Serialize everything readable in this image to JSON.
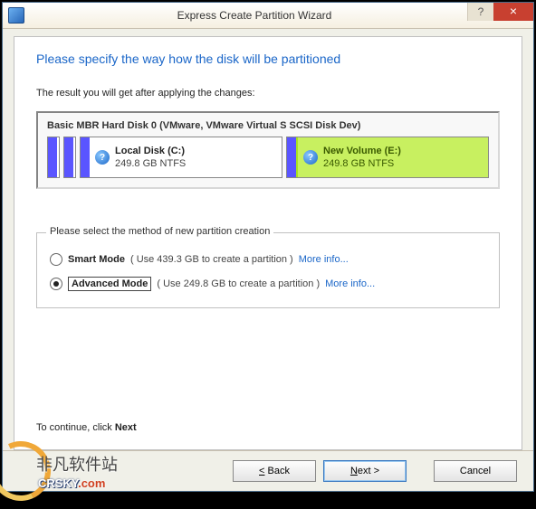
{
  "window": {
    "title": "Express Create Partition Wizard"
  },
  "main": {
    "heading": "Please specify the way how the disk will be partitioned",
    "result_label": "The result you will get after applying the changes:"
  },
  "disk": {
    "title": "Basic MBR Hard Disk 0 (VMware, VMware Virtual S SCSI Disk Dev)",
    "partitions": [
      {
        "name": "Local Disk (C:)",
        "size": "249.8 GB NTFS"
      },
      {
        "name": "New Volume (E:)",
        "size": "249.8 GB NTFS"
      }
    ]
  },
  "method": {
    "legend": "Please select the method of new partition creation",
    "smart": {
      "label": "Smart Mode",
      "desc": "( Use 439.3 GB to create a partition )",
      "more": "More info..."
    },
    "advanced": {
      "label": "Advanced Mode",
      "desc": "( Use 249.8 GB to create a partition )",
      "more": "More info..."
    }
  },
  "footer": {
    "continue_prefix": "To continue, click ",
    "continue_bold": "Next",
    "back": "< Back",
    "next": "Next >",
    "cancel": "Cancel"
  },
  "watermark": {
    "text": "非凡软件站",
    "url_main": "CRSKY",
    "url_suffix": ".com"
  }
}
